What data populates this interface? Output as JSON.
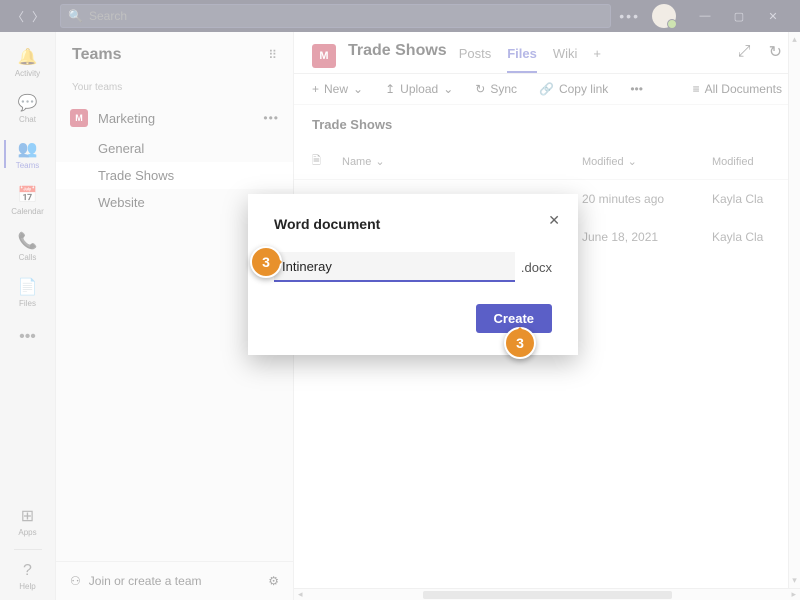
{
  "search_placeholder": "Search",
  "rail": [
    {
      "icon": "🔔",
      "label": "Activity"
    },
    {
      "icon": "💬",
      "label": "Chat"
    },
    {
      "icon": "👥",
      "label": "Teams"
    },
    {
      "icon": "📅",
      "label": "Calendar"
    },
    {
      "icon": "📞",
      "label": "Calls"
    },
    {
      "icon": "📄",
      "label": "Files"
    }
  ],
  "rail_apps_label": "Apps",
  "rail_help_label": "Help",
  "teams_heading": "Teams",
  "your_teams_label": "Your teams",
  "team_name": "Marketing",
  "team_initial": "M",
  "channels": [
    "General",
    "Trade Shows",
    "Website"
  ],
  "join_team_label": "Join or create a team",
  "channel_title": "Trade Shows",
  "channel_initial": "M",
  "tabs": [
    "Posts",
    "Files",
    "Wiki"
  ],
  "toolbar": {
    "new": "New",
    "upload": "Upload",
    "sync": "Sync",
    "copylink": "Copy link",
    "alldocs": "All Documents"
  },
  "breadcrumb": "Trade Shows",
  "cols": {
    "name": "Name",
    "modified": "Modified",
    "modifiedby": "Modified"
  },
  "files": [
    {
      "modified": "20 minutes ago",
      "by": "Kayla Cla"
    },
    {
      "modified": "June 18, 2021",
      "by": "Kayla Cla"
    }
  ],
  "modal": {
    "title": "Word document",
    "value": "Intineray",
    "ext": ".docx",
    "create": "Create"
  },
  "callout_num": "3"
}
